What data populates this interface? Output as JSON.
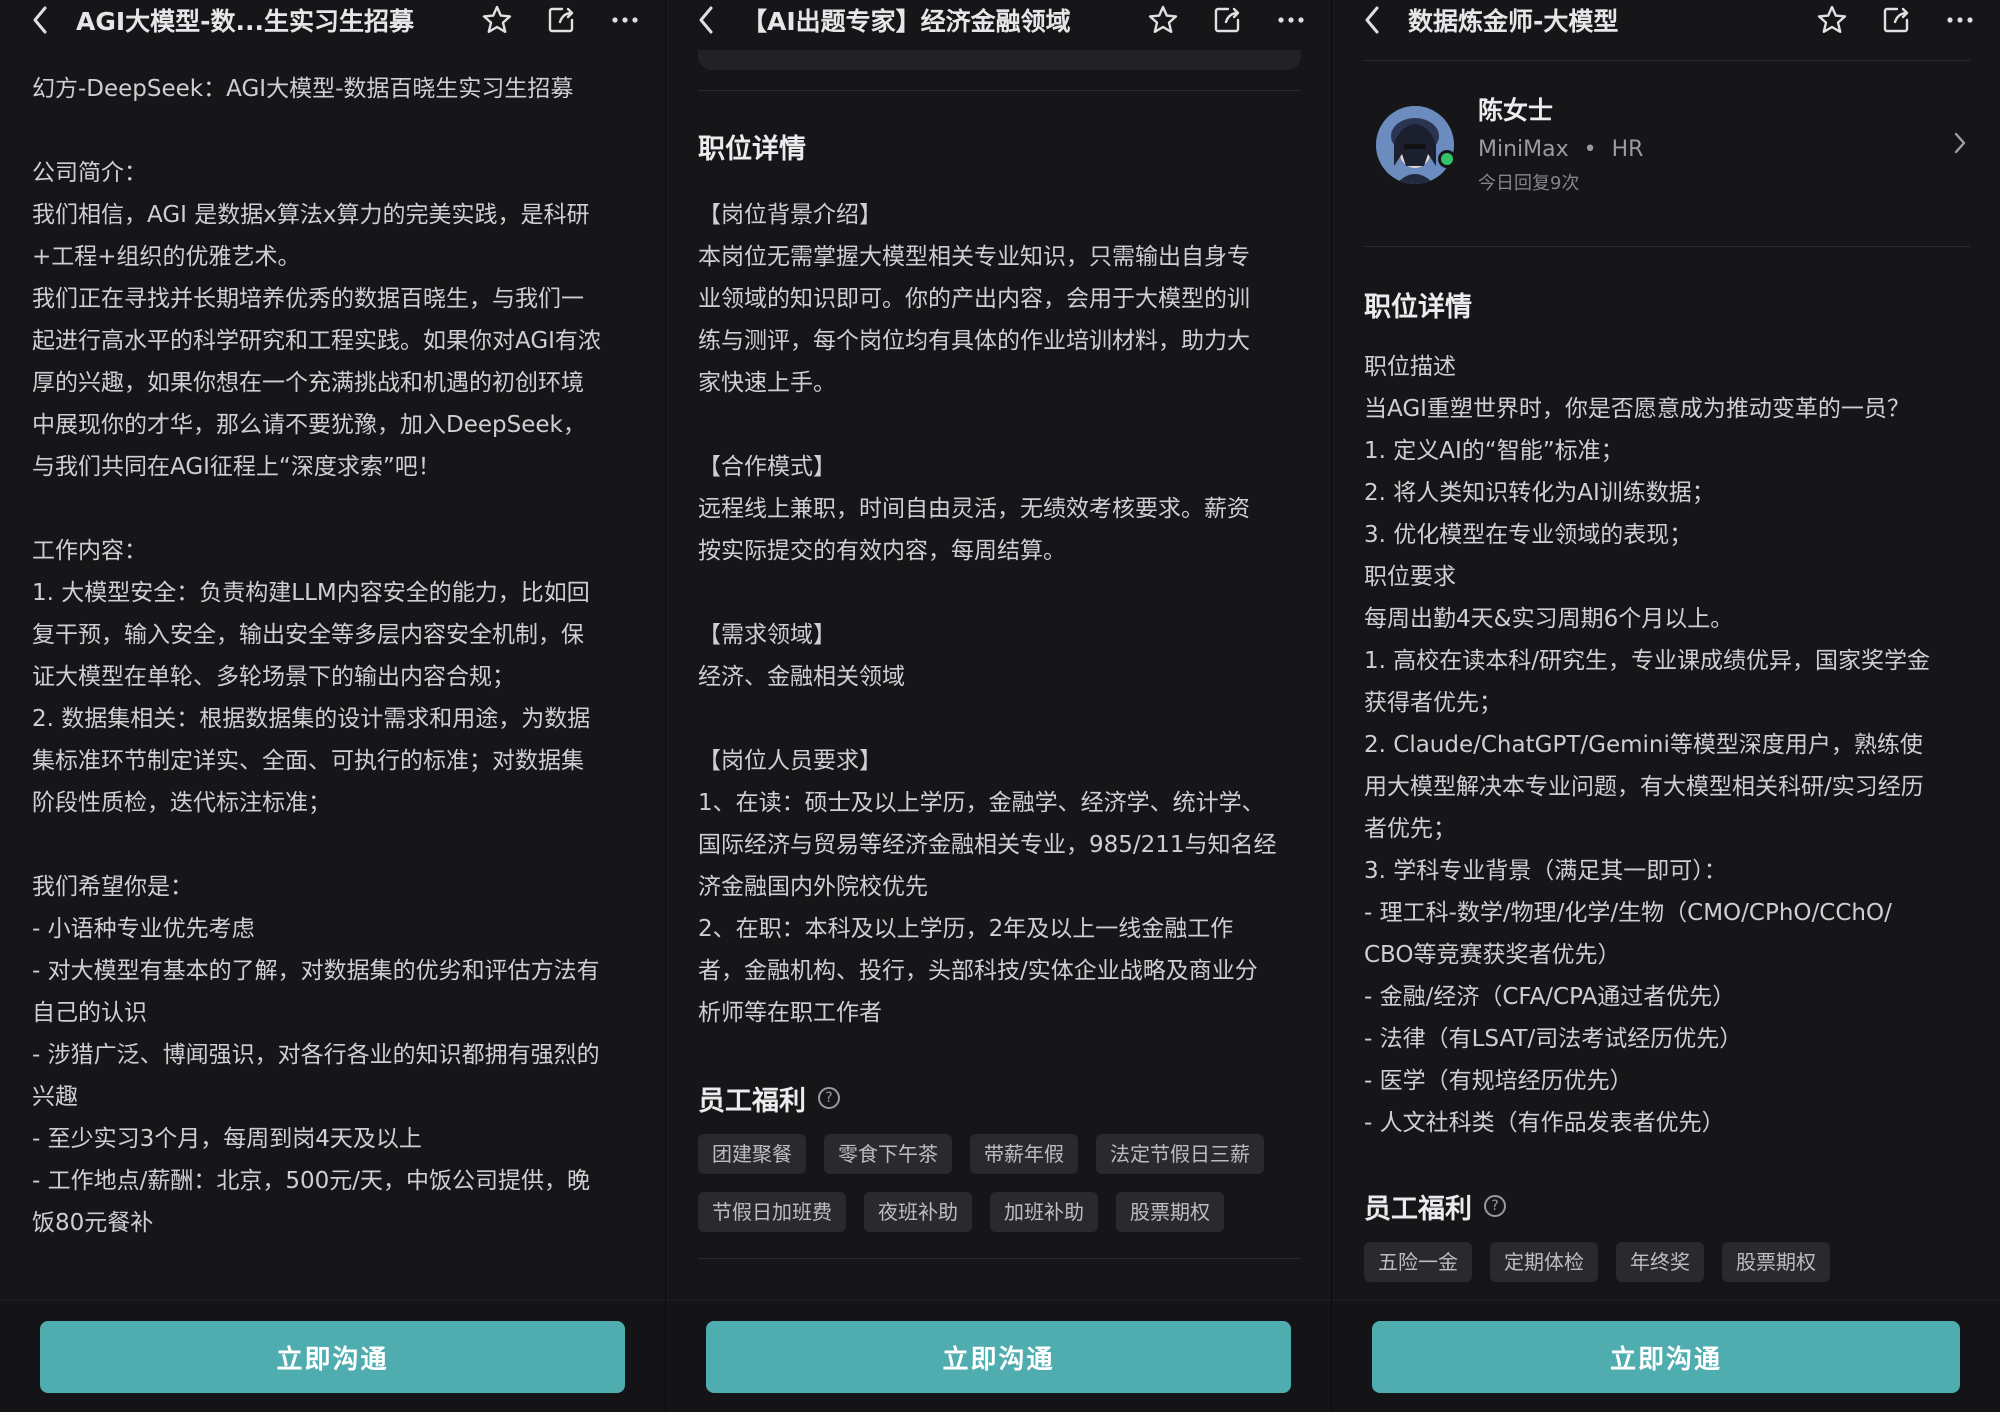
{
  "panels": [
    {
      "title": "AGI大模型-数...生实习生招募",
      "lines": [
        "幻方-DeepSeek：AGI大模型-数据百晓生实习生招募",
        "",
        "公司简介：",
        "我们相信，AGI 是数据x算法x算力的完美实践，是科研",
        "+工程+组织的优雅艺术。",
        "我们正在寻找并长期培养优秀的数据百晓生，与我们一",
        "起进行高水平的科学研究和工程实践。如果你对AGI有浓",
        "厚的兴趣，如果你想在一个充满挑战和机遇的初创环境",
        "中展现你的才华，那么请不要犹豫，加入DeepSeek，",
        "与我们共同在AGI征程上“深度求索”吧！",
        "",
        "工作内容：",
        "1. 大模型安全：负责构建LLM内容安全的能力，比如回",
        "复干预，输入安全，输出安全等多层内容安全机制，保",
        "证大模型在单轮、多轮场景下的输出内容合规；",
        "2. 数据集相关：根据数据集的设计需求和用途，为数据",
        "集标准环节制定详实、全面、可执行的标准；对数据集",
        "阶段性质检，迭代标注标准；",
        "",
        "我们希望你是：",
        "- 小语种专业优先考虑",
        "- 对大模型有基本的了解，对数据集的优劣和评估方法有",
        "自己的认识",
        "- 涉猎广泛、博闻强识，对各行各业的知识都拥有强烈的",
        "兴趣",
        "- 至少实习3个月，每周到岗4天及以上",
        "- 工作地点/薪酬：北京，500元/天，中饭公司提供，晚",
        "饭80元餐补"
      ],
      "cta": "立即沟通"
    },
    {
      "title": "【AI出题专家】经济金融领域",
      "section_title": "职位详情",
      "lines": [
        "【岗位背景介绍】",
        "本岗位无需掌握大模型相关专业知识，只需输出自身专",
        "业领域的知识即可。你的产出内容，会用于大模型的训",
        "练与测评，每个岗位均有具体的作业培训材料，助力大",
        "家快速上手。",
        "",
        "【合作模式】",
        "远程线上兼职，时间自由灵活，无绩效考核要求。薪资",
        "按实际提交的有效内容，每周结算。",
        "",
        "【需求领域】",
        "经济、金融相关领域",
        "",
        "【岗位人员要求】",
        "1、在读：硕士及以上学历，金融学、经济学、统计学、",
        "国际经济与贸易等经济金融相关专业，985/211与知名经",
        "济金融国内外院校优先",
        "2、在职：本科及以上学历，2年及以上一线金融工作",
        "者，金融机构、投行，头部科技/实体企业战略及商业分",
        "析师等在职工作者"
      ],
      "benefits_title": "员工福利",
      "benefits": [
        "团建聚餐",
        "零食下午茶",
        "带薪年假",
        "法定节假日三薪",
        "节假日加班费",
        "夜班补助",
        "加班补助",
        "股票期权"
      ],
      "cta": "立即沟通"
    },
    {
      "title": "数据炼金师-大模型",
      "hr": {
        "name": "陈女士",
        "company": "MiniMax",
        "dot": "•",
        "role": "HR",
        "reply": "今日回复9次"
      },
      "section_title": "职位详情",
      "lines": [
        "职位描述",
        "当AGI重塑世界时，你是否愿意成为推动变革的一员？",
        "1. 定义AI的“智能”标准；",
        "2. 将人类知识转化为AI训练数据；",
        "3. 优化模型在专业领域的表现；",
        "职位要求",
        "每周出勤4天&实习周期6个月以上。",
        "1. 高校在读本科/研究生，专业课成绩优异，国家奖学金",
        "获得者优先；",
        "2. Claude/ChatGPT/Gemini等模型深度用户，熟练使",
        "用大模型解决本专业问题，有大模型相关科研/实习经历",
        "者优先；",
        "3. 学科专业背景（满足其一即可）：",
        "- 理工科-数学/物理/化学/生物（CMO/CPhO/CChO/",
        "CBO等竞赛获奖者优先）",
        "- 金融/经济（CFA/CPA通过者优先）",
        "- 法律（有LSAT/司法考试经历优先）",
        "- 医学（有规培经历优先）",
        "- 人文社科类（有作品发表者优先）"
      ],
      "benefits_title": "员工福利",
      "benefits": [
        "五险一金",
        "定期体检",
        "年终奖",
        "股票期权"
      ],
      "cta": "立即沟通"
    }
  ]
}
